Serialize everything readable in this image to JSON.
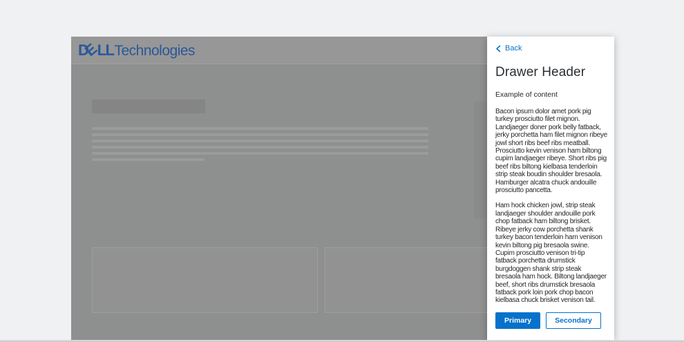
{
  "page": {
    "brand": {
      "dell_d": "D",
      "dell_e": "E",
      "dell_ll": "LL",
      "tech": "Technologies"
    }
  },
  "drawer": {
    "back_label": "Back",
    "title": "Drawer Header",
    "content_label": "Example of content",
    "paragraphs": [
      "Bacon ipsum dolor amet pork pig turkey prosciutto filet mignon. Landjaeger doner pork belly fatback, jerky porchetta ham filet mignon ribeye jowl short ribs beef ribs meatball. Prosciutto kevin venison ham biltong cupim landjaeger ribeye. Short ribs pig beef ribs biltong kielbasa tenderloin strip steak boudin shoulder bresaola. Hamburger alcatra chuck andouille prosciutto pancetta.",
      "Ham hock chicken jowl, strip steak landjaeger shoulder andouille pork chop fatback ham biltong brisket. Ribeye jerky cow porchetta shank turkey bacon tenderloin ham venison kevin biltong pig bresaola swine. Cupim prosciutto venison tri-tip fatback porchetta drumstick burgdoggen shank strip steak bresaola ham hock. Biltong landjaeger beef, short ribs drumstick bresaola fatback pork loin pork chop bacon kielbasa chuck brisket venison tail."
    ],
    "buttons": {
      "primary": "Primary",
      "secondary": "Secondary"
    }
  },
  "colors": {
    "accent_blue": "#0672cb",
    "logo_blue": "#2a589b",
    "drawer_bg": "#ffffff",
    "dimmed_page_bg": "#8e8f8f",
    "dimmed_header_bg": "#979797",
    "outer_bg": "#eff1f3",
    "text_dark": "#262626"
  }
}
